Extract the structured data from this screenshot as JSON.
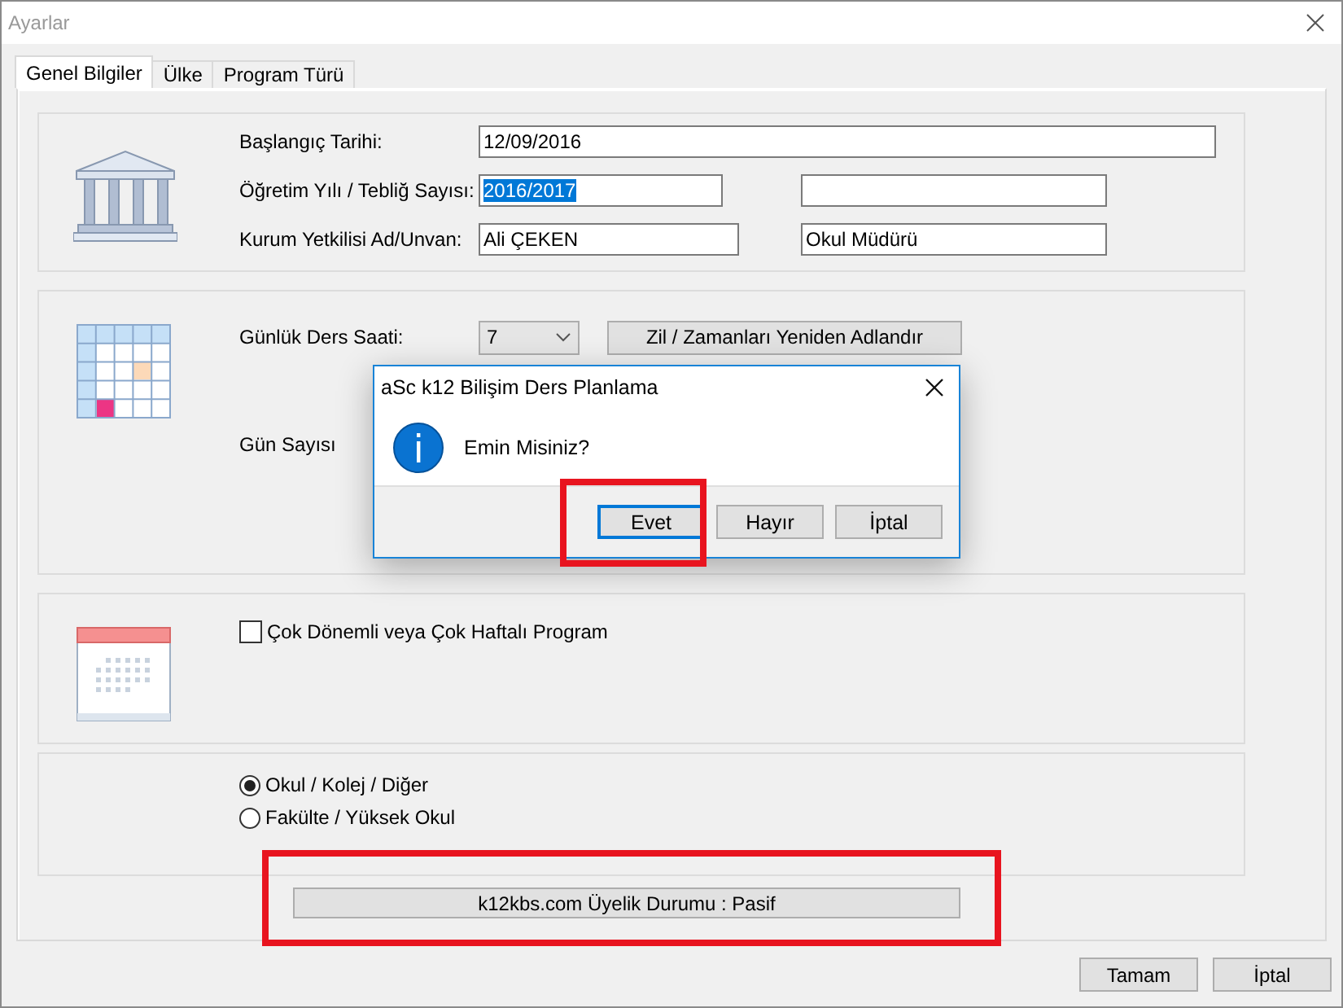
{
  "window": {
    "title": "Ayarlar"
  },
  "tabs": [
    {
      "label": "Genel Bilgiler",
      "selected": true
    },
    {
      "label": "Ülke",
      "selected": false
    },
    {
      "label": "Program Türü",
      "selected": false
    }
  ],
  "institution": {
    "fields": [
      {
        "kind": "wide",
        "label": "Başlangıç Tarihi:",
        "value": "12/09/2016"
      },
      {
        "kind": "pair",
        "label": "Öğretim Yılı / Tebliğ Sayısı:",
        "value": "2016/2017",
        "highlighted": true
      },
      {
        "kind": "pair",
        "label": "Kurum Yetkilisi Ad/Unvan:",
        "value": "Ali ÇEKEN",
        "second_value": "Okul Müdürü"
      }
    ]
  },
  "schedule": {
    "lessons_label": "Günlük Ders Saati:",
    "lessons_value": "7",
    "rename_button": "Zil / Zamanları Yeniden Adlandır",
    "days_label": "Gün Sayısı"
  },
  "multi_term": {
    "label": "Çok Dönemli veya Çok Haftalı Program",
    "checked": false
  },
  "institution_type": [
    {
      "label": "Okul / Kolej / Diğer",
      "selected": true
    },
    {
      "label": "Fakülte / Yüksek Okul",
      "selected": false
    }
  ],
  "membership_button": "k12kbs.com Üyelik Durumu : Pasif",
  "buttons": [
    "Tamam",
    "İptal"
  ],
  "dialog": {
    "title": "aSc k12 Bilişim Ders Planlama",
    "message": "Emin Misiniz?",
    "buttons": [
      {
        "label": "Evet",
        "selected": true
      },
      {
        "label": "Hayır",
        "selected": false
      },
      {
        "label": "İptal",
        "selected": false
      }
    ]
  }
}
